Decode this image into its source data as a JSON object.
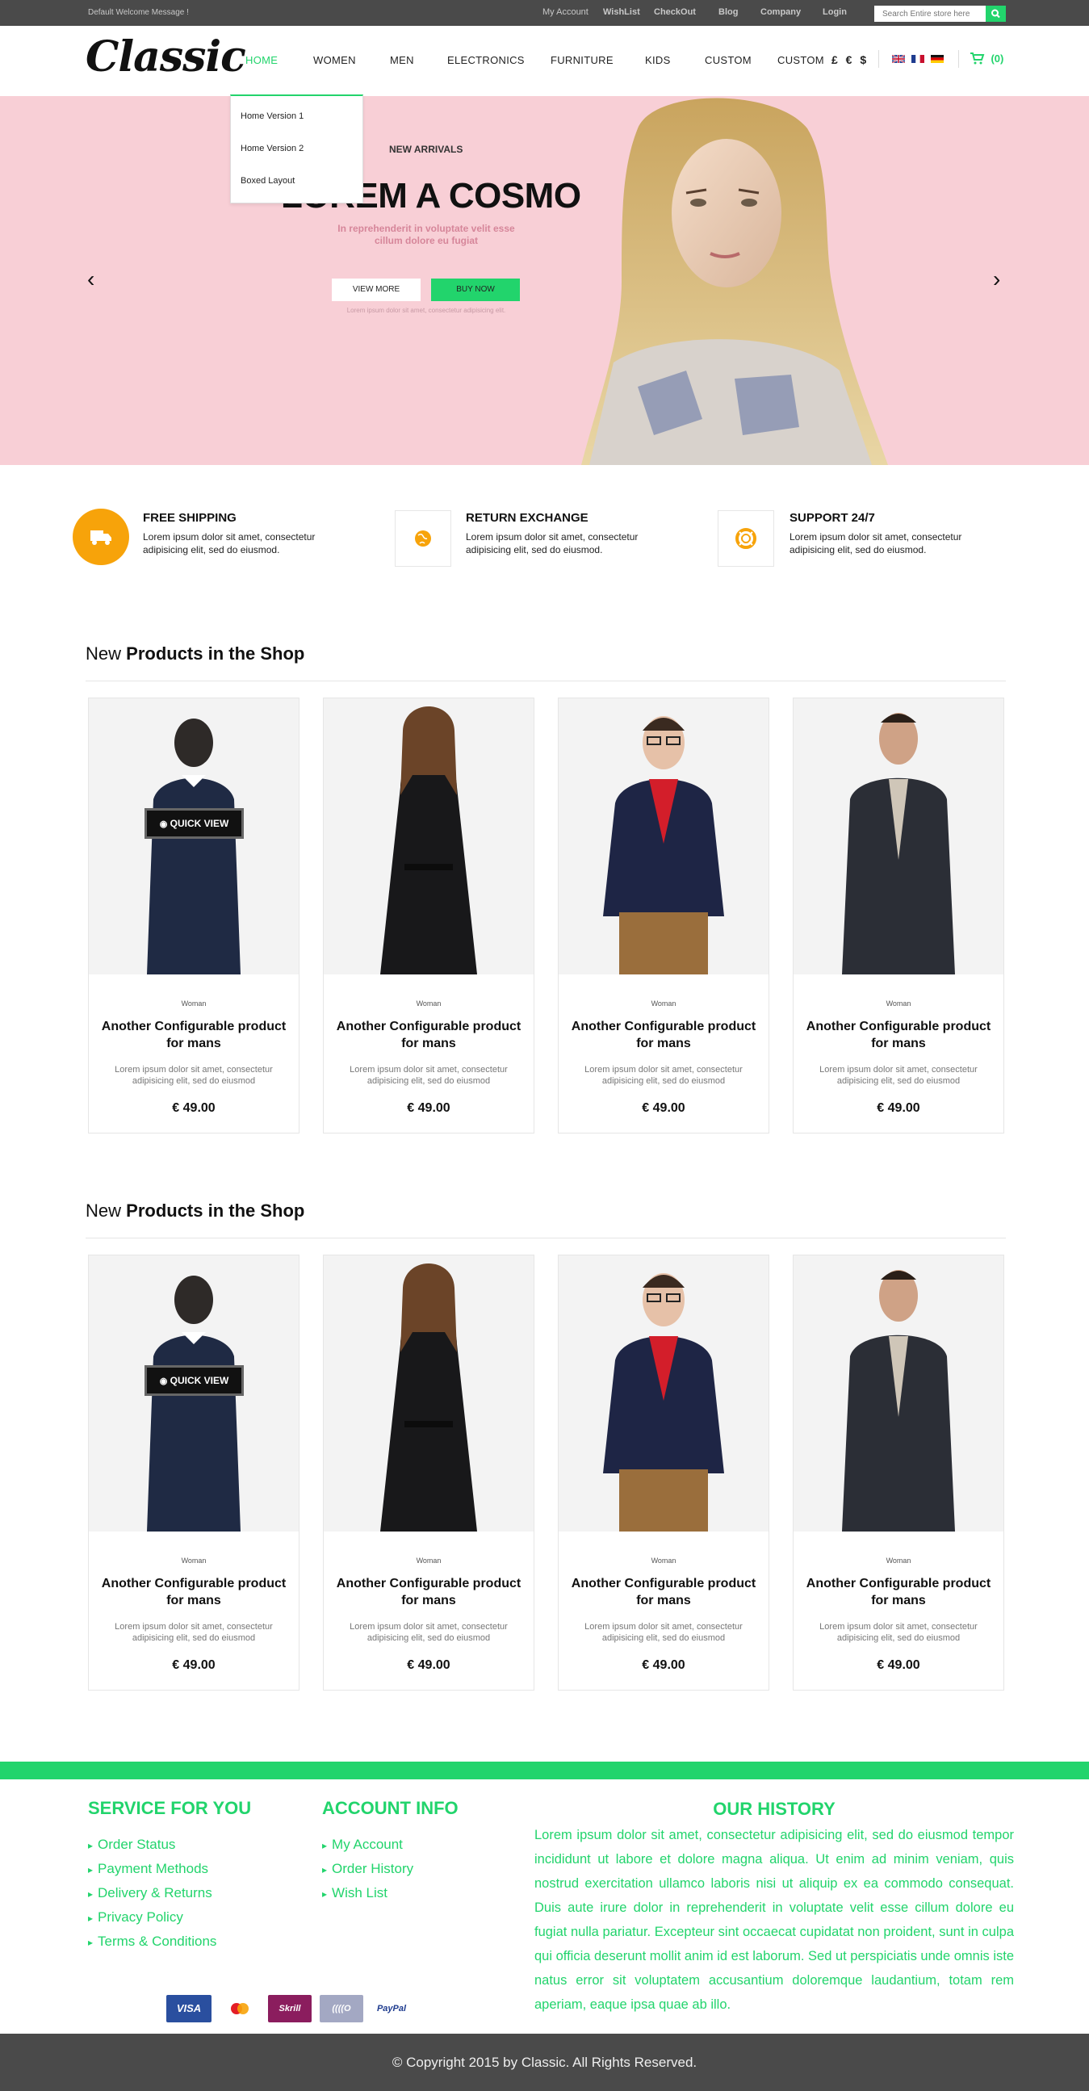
{
  "topbar": {
    "welcome": "Default Welcome Message !",
    "links": [
      "My Account",
      "WishList",
      "CheckOut",
      "Blog",
      "Company",
      "Login"
    ],
    "search_placeholder": "Search Entire store here"
  },
  "header": {
    "logo": "Classic",
    "nav": [
      "HOME",
      "WOMEN",
      "MEN",
      "ELECTRONICS",
      "FURNITURE",
      "KIDS",
      "CUSTOM",
      "CUSTOM"
    ],
    "currency": "£ € $",
    "cart": "(0)"
  },
  "dropdown": [
    "Home Version 1",
    "Home Version 2",
    "Boxed Layout"
  ],
  "hero": {
    "eyebrow": "NEW ARRIVALS",
    "title": "LOREM A COSMO",
    "subtitle": "In reprehenderit in voluptate velit esse cillum dolore eu fugiat",
    "btn_view": "VIEW MORE",
    "btn_buy": "BUY NOW",
    "small": "Lorem ipsum dolor sit amet, consectetur adipisicing elit."
  },
  "features": [
    {
      "title": "FREE SHIPPING",
      "text": "Lorem ipsum dolor sit amet, consectetur adipisicing elit, sed do eiusmod."
    },
    {
      "title": "RETURN EXCHANGE",
      "text": "Lorem ipsum dolor sit amet, consectetur adipisicing elit, sed do eiusmod."
    },
    {
      "title": "SUPPORT 24/7",
      "text": "Lorem ipsum dolor sit amet, consectetur adipisicing elit, sed do eiusmod."
    }
  ],
  "sections": [
    {
      "title_light": "New",
      "title_bold": "Products in the Shop"
    },
    {
      "title_light": "New",
      "title_bold": "Products in the Shop"
    }
  ],
  "quick_view": "QUICK VIEW",
  "product": {
    "category": "Woman",
    "name": "Another Configurable product for mans",
    "desc": "Lorem ipsum dolor sit amet, consectetur adipisicing elit, sed do eiusmod",
    "price": "€ 49.00"
  },
  "footer": {
    "service_title": "SERVICE FOR YOU",
    "service_links": [
      "Order Status",
      "Payment Methods",
      "Delivery & Returns",
      "Privacy Policy",
      "Terms & Conditions"
    ],
    "account_title": "ACCOUNT INFO",
    "account_links": [
      "My Account",
      "Order History",
      "Wish List"
    ],
    "history_title": "OUR HISTORY",
    "history_text": "Lorem ipsum dolor sit amet, consectetur adipisicing elit, sed do eiusmod tempor incididunt ut labore et dolore magna aliqua. Ut enim ad minim veniam, quis nostrud exercitation ullamco laboris nisi ut aliquip ex ea commodo consequat. Duis aute irure dolor in reprehenderit in voluptate velit esse cillum dolore eu fugiat nulla pariatur. Excepteur sint occaecat cupidatat non proident, sunt in culpa qui officia deserunt mollit anim id est laborum. Sed ut perspiciatis unde omnis iste natus error sit voluptatem accusantium doloremque laudantium, totam rem aperiam, eaque ipsa quae ab illo.",
    "payments": [
      "VISA",
      "MasterCard",
      "Skrill",
      "((((O",
      "PayPal"
    ],
    "copyright": "© Copyright 2015 by Classic. All Rights Reserved."
  },
  "colors": {
    "accent": "#22d46c",
    "hero_bg": "#f8cfd6",
    "bar": "#4a4a4a",
    "feature_orange": "#f7a30a"
  }
}
